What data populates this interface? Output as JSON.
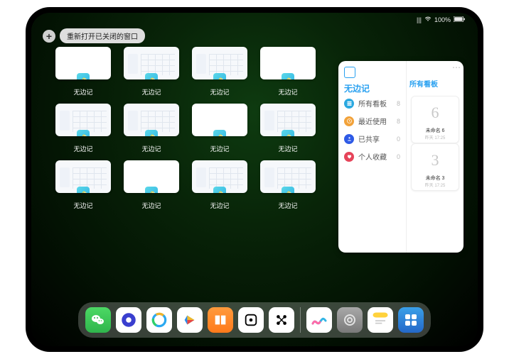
{
  "status": {
    "signal": "|||",
    "wifi": "⌵",
    "battery": "100%"
  },
  "topbar": {
    "plus": "+",
    "reopen_label": "重新打开已关闭的窗口"
  },
  "app_label": "无边记",
  "thumbs": [
    {
      "style": "blank"
    },
    {
      "style": "cal"
    },
    {
      "style": "cal"
    },
    {
      "style": "blank"
    },
    {
      "style": "cal"
    },
    {
      "style": "cal"
    },
    {
      "style": "blank"
    },
    {
      "style": "cal"
    },
    {
      "style": "cal"
    },
    {
      "style": "blank"
    },
    {
      "style": "cal"
    },
    {
      "style": "cal"
    }
  ],
  "panel": {
    "title": "无边记",
    "rows": [
      {
        "label": "所有看板",
        "count": "8",
        "color": "d1"
      },
      {
        "label": "最近使用",
        "count": "8",
        "color": "d2"
      },
      {
        "label": "已共享",
        "count": "0",
        "color": "d3"
      },
      {
        "label": "个人收藏",
        "count": "0",
        "color": "d4"
      }
    ],
    "right_title": "所有看板",
    "cards": [
      {
        "glyph": "6",
        "name": "未命名 6",
        "sub": "昨天 17:25"
      },
      {
        "glyph": "3",
        "name": "未命名 3",
        "sub": "昨天 17:25"
      }
    ]
  },
  "dock": [
    {
      "name": "wechat",
      "cls": "di-wc"
    },
    {
      "name": "purple-circle",
      "cls": "di-pp"
    },
    {
      "name": "q-browser",
      "cls": "di-q"
    },
    {
      "name": "play",
      "cls": "di-tri"
    },
    {
      "name": "books",
      "cls": "di-bk"
    },
    {
      "name": "dice",
      "cls": "di-sq"
    },
    {
      "name": "games",
      "cls": "di-dots"
    },
    {
      "name": "sep"
    },
    {
      "name": "freeform",
      "cls": "di-ff"
    },
    {
      "name": "settings",
      "cls": "di-set"
    },
    {
      "name": "notes",
      "cls": "di-nt"
    },
    {
      "name": "app-library",
      "cls": "di-grid"
    }
  ]
}
